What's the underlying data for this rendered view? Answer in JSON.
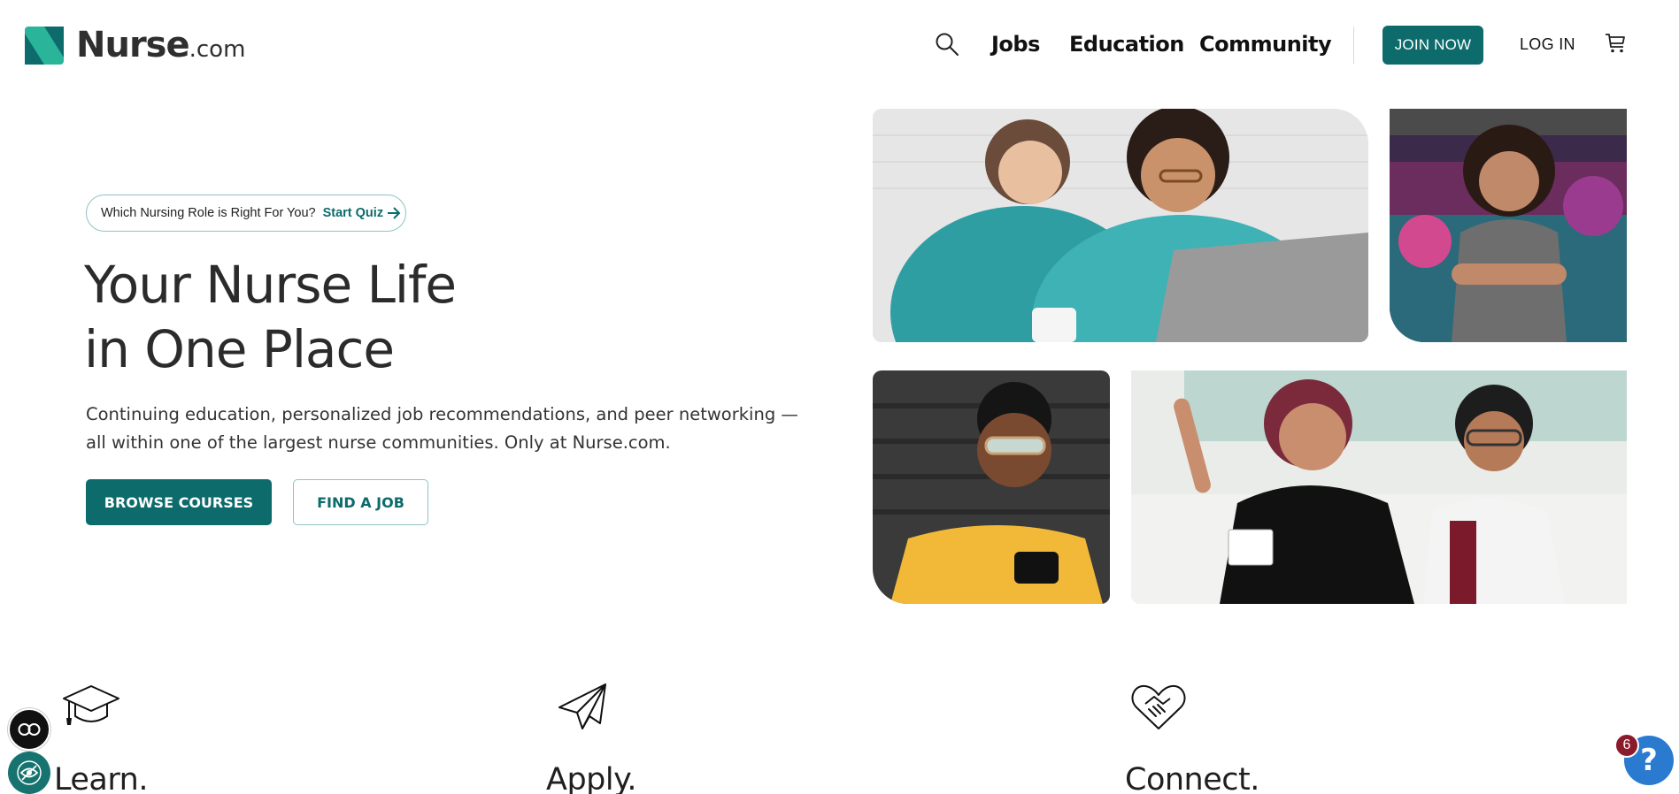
{
  "brand": {
    "name": "Nurse",
    "tld": ".com",
    "color": "#0d6b6b"
  },
  "nav": {
    "items": [
      {
        "label": "Jobs"
      },
      {
        "label": "Education"
      },
      {
        "label": "Community"
      }
    ],
    "join_label": "JOIN NOW",
    "login_label": "LOG IN",
    "icons": [
      "search-icon",
      "cart-icon"
    ]
  },
  "hero": {
    "quiz": {
      "question": "Which Nursing Role is Right For You?",
      "cta": "Start Quiz"
    },
    "title_line1": "Your Nurse Life",
    "title_line2": "in One Place",
    "description": "Continuing education, personalized job recommendations, and peer networking — all within one of the largest nurse communities. Only at Nurse.com.",
    "primary_button": "BROWSE COURSES",
    "secondary_button": "FIND A JOB"
  },
  "features": [
    {
      "label": "Learn.",
      "icon": "graduation-cap-icon"
    },
    {
      "label": "Apply.",
      "icon": "paper-plane-icon"
    },
    {
      "label": "Connect.",
      "icon": "heart-handshake-icon"
    }
  ],
  "widgets": {
    "help_badge_count": "6",
    "help_symbol": "?"
  },
  "colors": {
    "accent": "#0d6b6b",
    "outline": "#8fc3c3",
    "help": "#2a7bd0",
    "badge": "#8b1a2b"
  }
}
